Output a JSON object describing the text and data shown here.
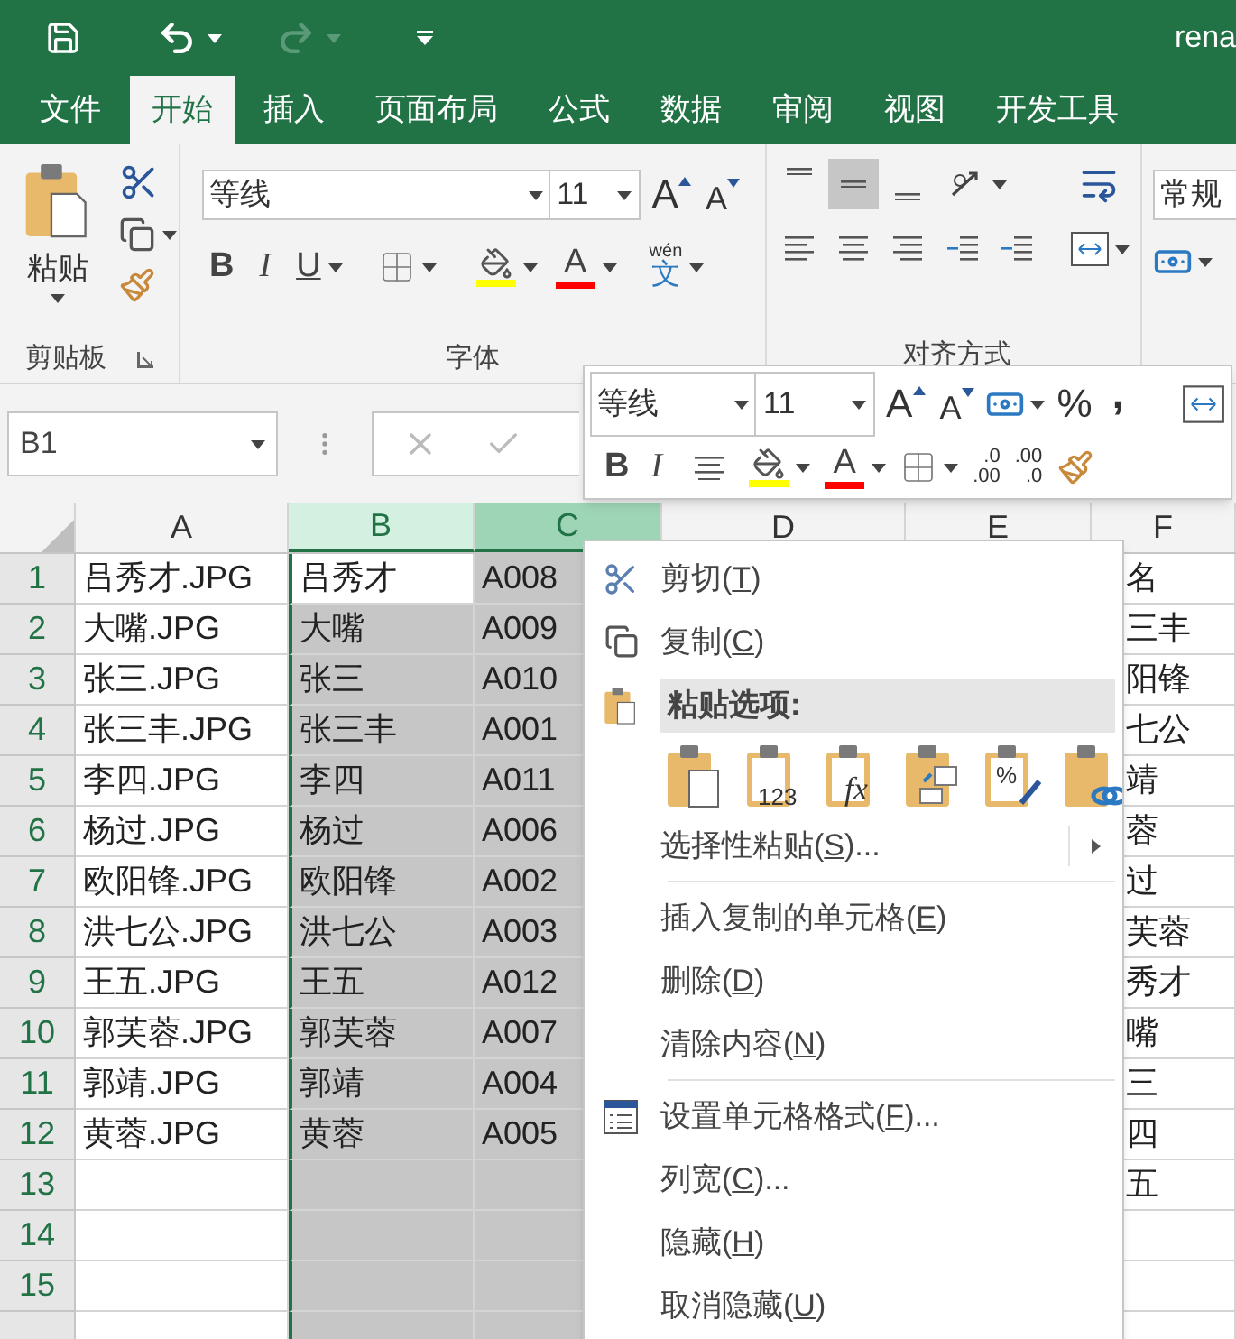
{
  "quick_access": [
    {
      "kind": "save",
      "disabled": false
    },
    {
      "kind": "undo",
      "disabled": false
    },
    {
      "kind": "redo",
      "disabled": true
    },
    {
      "kind": "customize",
      "disabled": false
    }
  ],
  "title": "rena",
  "tabs": [
    {
      "label": "文件",
      "selected": false
    },
    {
      "label": "开始",
      "selected": true
    },
    {
      "label": "插入",
      "selected": false
    },
    {
      "label": "页面布局",
      "selected": false
    },
    {
      "label": "公式",
      "selected": false
    },
    {
      "label": "数据",
      "selected": false
    },
    {
      "label": "审阅",
      "selected": false
    },
    {
      "label": "视图",
      "selected": false
    },
    {
      "label": "开发工具",
      "selected": false
    }
  ],
  "ribbon": {
    "clipboard": {
      "paste": "粘贴",
      "label": "剪贴板"
    },
    "font": {
      "font_name": "等线",
      "font_size": "11",
      "grow": "A",
      "shrink": "A",
      "bold": "B",
      "italic": "I",
      "underline": "U",
      "font_color": "A",
      "phonetic": "wén",
      "phonetic_base": "文",
      "label": "字体"
    },
    "alignment": {
      "vertical": [
        {
          "kind": "top",
          "selected": false
        },
        {
          "kind": "middle",
          "selected": true
        },
        {
          "kind": "bottom",
          "selected": false
        }
      ],
      "label": "对齐方式"
    },
    "number": {
      "format": "常规"
    }
  },
  "formula_bar": {
    "name_box": "B1",
    "cancel_disabled": true,
    "enter_disabled": true
  },
  "columns": [
    {
      "label": "A",
      "selected": false
    },
    {
      "label": "B",
      "selected": true
    },
    {
      "label": "C",
      "selected": true
    },
    {
      "label": "D",
      "selected": false
    },
    {
      "label": "E",
      "selected": false
    },
    {
      "label": "F",
      "selected": false
    }
  ],
  "rows": [
    {
      "number": "1",
      "active": true,
      "a": "吕秀才.JPG",
      "b": "吕秀才",
      "c": "A008",
      "f": "名"
    },
    {
      "number": "2",
      "active": false,
      "a": "大嘴.JPG",
      "b": "大嘴",
      "c": "A009",
      "f": "三丰"
    },
    {
      "number": "3",
      "active": false,
      "a": "张三.JPG",
      "b": "张三",
      "c": "A010",
      "f": "阳锋"
    },
    {
      "number": "4",
      "active": false,
      "a": "张三丰.JPG",
      "b": "张三丰",
      "c": "A001",
      "f": "七公"
    },
    {
      "number": "5",
      "active": false,
      "a": "李四.JPG",
      "b": "李四",
      "c": "A011",
      "f": "靖"
    },
    {
      "number": "6",
      "active": false,
      "a": "杨过.JPG",
      "b": "杨过",
      "c": "A006",
      "f": "蓉"
    },
    {
      "number": "7",
      "active": false,
      "a": "欧阳锋.JPG",
      "b": "欧阳锋",
      "c": "A002",
      "f": "过"
    },
    {
      "number": "8",
      "active": false,
      "a": "洪七公.JPG",
      "b": "洪七公",
      "c": "A003",
      "f": "芙蓉"
    },
    {
      "number": "9",
      "active": false,
      "a": "王五.JPG",
      "b": "王五",
      "c": "A012",
      "f": "秀才"
    },
    {
      "number": "10",
      "active": false,
      "a": "郭芙蓉.JPG",
      "b": "郭芙蓉",
      "c": "A007",
      "f": "嘴"
    },
    {
      "number": "11",
      "active": false,
      "a": "郭靖.JPG",
      "b": "郭靖",
      "c": "A004",
      "f": "三"
    },
    {
      "number": "12",
      "active": false,
      "a": "黄蓉.JPG",
      "b": "黄蓉",
      "c": "A005",
      "f": "四"
    },
    {
      "number": "13",
      "active": false,
      "f": "五"
    },
    {
      "number": "14",
      "active": false
    },
    {
      "number": "15",
      "active": false
    },
    {
      "active": false
    }
  ],
  "mini_toolbar": {
    "font_name": "等线",
    "font_size": "11",
    "grow": "A",
    "shrink": "A",
    "percent": "%",
    "comma": ",",
    "bold": "B",
    "italic": "I",
    "font_color": "A",
    "increase_decimal": [
      ".0",
      ".00"
    ],
    "decrease_decimal": [
      ".00",
      ".0"
    ]
  },
  "context_menu": [
    {
      "kind": "cut",
      "parts": [
        "剪切(",
        "T",
        ")"
      ]
    },
    {
      "kind": "copy",
      "parts": [
        "复制(",
        "C",
        ")"
      ]
    },
    {
      "kind": "heading",
      "label": "粘贴选项:"
    },
    {
      "kind": "pastebar",
      "options": [
        {
          "kind": "paste"
        },
        {
          "kind": "values",
          "text": "123"
        },
        {
          "kind": "formulas",
          "text": "fx"
        },
        {
          "kind": "transpose"
        },
        {
          "kind": "formatting",
          "text": "%"
        },
        {
          "kind": "link"
        }
      ]
    },
    {
      "kind": "submenu",
      "parts": [
        "选择性粘贴(",
        "S",
        ")..."
      ]
    },
    {
      "kind": "separator"
    },
    {
      "kind": "command",
      "parts": [
        "插入复制的单元格(",
        "E",
        ")"
      ]
    },
    {
      "kind": "command",
      "parts": [
        "删除(",
        "D",
        ")"
      ]
    },
    {
      "kind": "command",
      "parts": [
        "清除内容(",
        "N",
        ")"
      ]
    },
    {
      "kind": "separator"
    },
    {
      "kind": "format",
      "parts": [
        "设置单元格格式(",
        "F",
        ")..."
      ]
    },
    {
      "kind": "command",
      "parts": [
        "列宽(",
        "C",
        ")..."
      ]
    },
    {
      "kind": "command",
      "parts": [
        "隐藏(",
        "H",
        ")"
      ]
    },
    {
      "kind": "command",
      "parts": [
        "取消隐藏(",
        "U",
        ")"
      ]
    }
  ]
}
